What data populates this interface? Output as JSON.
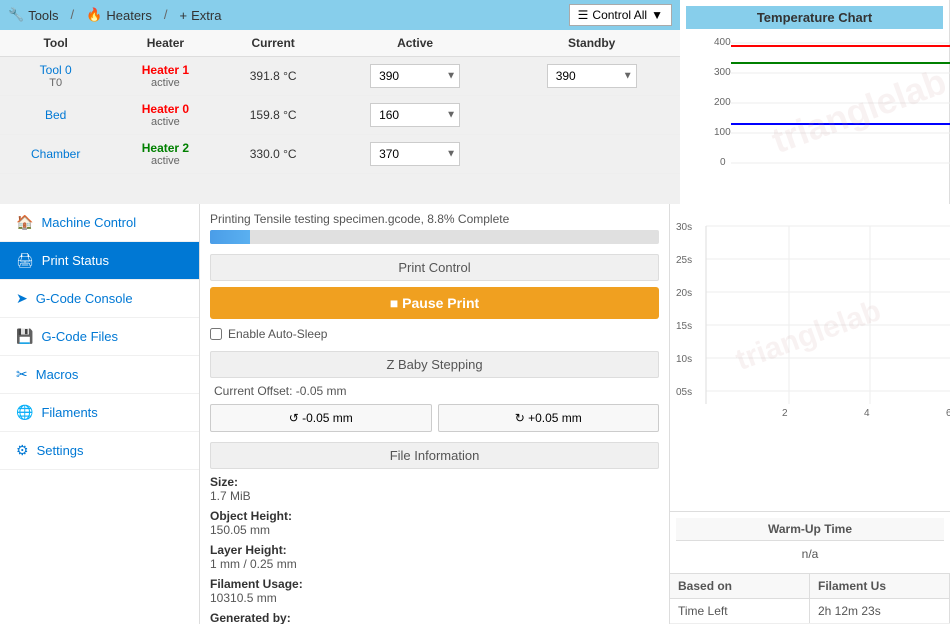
{
  "topbar": {
    "tools_label": "Tools",
    "heaters_label": "Heaters",
    "extra_label": "Extra",
    "control_all_label": "Control All"
  },
  "table": {
    "headers": [
      "Tool",
      "Heater",
      "Current",
      "Active",
      "Standby"
    ],
    "rows": [
      {
        "tool_name": "Tool 0",
        "tool_sub": "T0",
        "heater_name": "Heater 1",
        "heater_status": "active",
        "heater_color": "red",
        "current": "391.8 °C",
        "active": "390",
        "standby": "390"
      },
      {
        "tool_name": "Bed",
        "tool_sub": "",
        "heater_name": "Heater 0",
        "heater_status": "active",
        "heater_color": "red",
        "current": "159.8 °C",
        "active": "160",
        "standby": ""
      },
      {
        "tool_name": "Chamber",
        "tool_sub": "",
        "heater_name": "Heater 2",
        "heater_status": "active",
        "heater_color": "green",
        "current": "330.0 °C",
        "active": "370",
        "standby": ""
      }
    ]
  },
  "sidebar": {
    "items": [
      {
        "label": "Machine Control",
        "icon": "🏠",
        "id": "machine-control"
      },
      {
        "label": "Print Status",
        "icon": "🖨",
        "id": "print-status",
        "active": true
      },
      {
        "label": "G-Code Console",
        "icon": "➤",
        "id": "gcode-console"
      },
      {
        "label": "G-Code Files",
        "icon": "💾",
        "id": "gcode-files"
      },
      {
        "label": "Macros",
        "icon": "✂",
        "id": "macros"
      },
      {
        "label": "Filaments",
        "icon": "🌐",
        "id": "filaments"
      },
      {
        "label": "Settings",
        "icon": "⚙",
        "id": "settings"
      }
    ]
  },
  "print_status": {
    "progress_text": "Printing Tensile testing specimen.gcode, 8.8% Complete",
    "progress_pct": 8.8,
    "print_control_label": "Print Control",
    "pause_btn_label": "■ Pause Print",
    "auto_sleep_label": "Enable Auto-Sleep",
    "z_baby_label": "Z Baby Stepping",
    "z_offset_label": "Current Offset: -0.05 mm",
    "z_minus_label": "↺ -0.05 mm",
    "z_plus_label": "↻ +0.05 mm",
    "file_info_label": "File Information",
    "size_label": "Size:",
    "size_value": "1.7 MiB",
    "object_height_label": "Object Height:",
    "object_height_value": "150.05 mm",
    "layer_height_label": "Layer Height:",
    "layer_height_value": "1 mm / 0.25 mm",
    "filament_usage_label": "Filament Usage:",
    "filament_usage_value": "10310.5 mm",
    "generated_by_label": "Generated by:"
  },
  "temp_chart": {
    "title": "Temperature Chart",
    "y_labels": [
      "400",
      "300",
      "200",
      "100",
      "0"
    ],
    "lines": [
      {
        "color": "red",
        "values": [
          390,
          390,
          390,
          390,
          390
        ]
      },
      {
        "color": "blue",
        "values": [
          160,
          160,
          160,
          160,
          160
        ]
      },
      {
        "color": "green",
        "values": [
          330,
          330,
          330,
          330,
          330
        ]
      }
    ]
  },
  "time_chart": {
    "y_labels": [
      "30s",
      "25s",
      "20s",
      "15s",
      "10s",
      "05s"
    ],
    "x_labels": [
      "2",
      "4",
      "6"
    ]
  },
  "warmup": {
    "title": "Warm-Up Time",
    "value": "n/a"
  },
  "based_on": {
    "col1": "Based on",
    "col2": "Filament Us",
    "rows": [
      {
        "col1": "Time Left",
        "col2": "2h 12m 23s"
      }
    ]
  }
}
